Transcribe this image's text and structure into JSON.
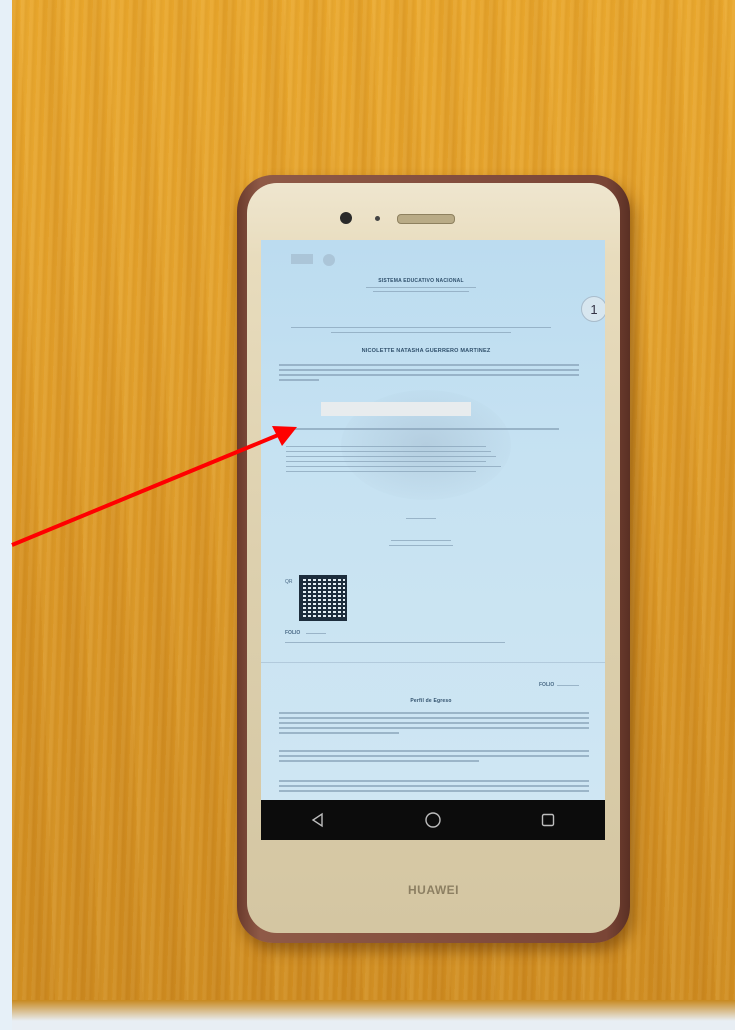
{
  "phone": {
    "brand": "HUAWEI"
  },
  "document": {
    "page_number": "1",
    "student_name": "NICOLETTE NATASHA GUERRERO MARTINEZ",
    "qr_label": "QR",
    "folio_label": "FOLIO",
    "folio_label_second": "FOLIO",
    "section_title": "Perfil de Egreso",
    "header_title": "SISTEMA EDUCATIVO NACIONAL"
  },
  "annotation": {
    "arrow_color": "#ff0000",
    "redaction_color": "#e8ecee"
  },
  "navbar": {
    "back_icon": "back-icon",
    "home_icon": "home-icon",
    "recent_icon": "recent-icon"
  }
}
